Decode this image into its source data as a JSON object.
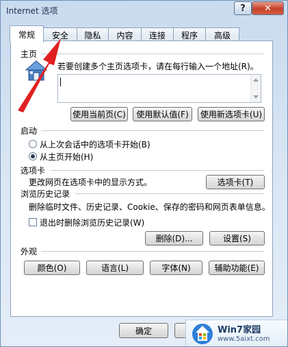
{
  "window": {
    "title": "Internet 选项",
    "help_label": "?",
    "close_label": "✕"
  },
  "tabs": [
    {
      "label": "常规",
      "active": true
    },
    {
      "label": "安全"
    },
    {
      "label": "隐私"
    },
    {
      "label": "内容"
    },
    {
      "label": "连接"
    },
    {
      "label": "程序"
    },
    {
      "label": "高级"
    }
  ],
  "homepage": {
    "label": "主页",
    "instruction": "若要创建多个主页选项卡，请在每行输入一个地址(R)。",
    "value": "",
    "use_current_button": "使用当前页(C)",
    "use_default_button": "使用默认值(F)",
    "use_new_tab_button": "使用新选项卡(U)",
    "icon": "house-icon"
  },
  "startup": {
    "label": "启动",
    "option1": "从上次会话中的选项卡开始(B)",
    "option2": "从主页开始(H)",
    "selected": 2
  },
  "tabs_section": {
    "label": "选项卡",
    "description": "更改网页在选项卡中的显示方式。",
    "button": "选项卡(T)"
  },
  "history": {
    "label": "浏览历史记录",
    "description": "删除临时文件、历史记录、Cookie、保存的密码和网页表单信息。",
    "checkbox_label": "退出时删除浏览历史记录(W)",
    "checked": false,
    "delete_button": "删除(D)...",
    "settings_button": "设置(S)"
  },
  "appearance": {
    "label": "外观",
    "colors_button": "颜色(O)",
    "languages_button": "语言(L)",
    "fonts_button": "字体(N)",
    "accessibility_button": "辅助功能(E)"
  },
  "bottom": {
    "ok_button": "确定"
  },
  "watermark": {
    "site_name": "Win7家园",
    "url": "www.5aixt.com"
  },
  "colors": {
    "arrow": "#e02020",
    "close_button": "#c4412a"
  }
}
